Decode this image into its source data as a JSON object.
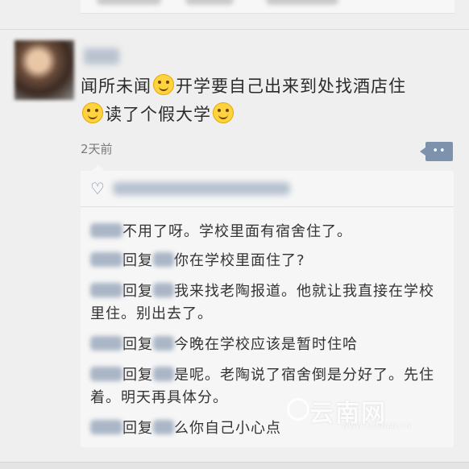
{
  "post": {
    "text_parts": [
      "闻所未闻",
      "开学要自己出来到处找酒店住",
      "读了个假大学"
    ],
    "emoji": "smile-emoji",
    "timestamp": "2天前",
    "comment_button": "••"
  },
  "likes": {
    "icon": "heart-outline-icon"
  },
  "comments": [
    {
      "reply_label": "",
      "text": "不用了呀。学校里面有宿舍住了。"
    },
    {
      "reply_label": "回复",
      "text": "你在学校里面住了?"
    },
    {
      "reply_label": "回复",
      "text": "我来找老陶报道。他就让我直接在学校里住。别出去了。"
    },
    {
      "reply_label": "回复",
      "text": "今晚在学校应该是暂时住哈"
    },
    {
      "reply_label": "回复",
      "text": "是呢。老陶说了宿舍倒是分好了。先住着。明天再具体分。"
    },
    {
      "reply_label": "回复",
      "text": "么你自己小心点"
    }
  ],
  "watermark": {
    "text": "云南网",
    "sub": "WWW.YUNNAN.CN"
  },
  "colors": {
    "link": "#576b95",
    "emoji": "#ffd23f",
    "button": "#7d93ad"
  }
}
